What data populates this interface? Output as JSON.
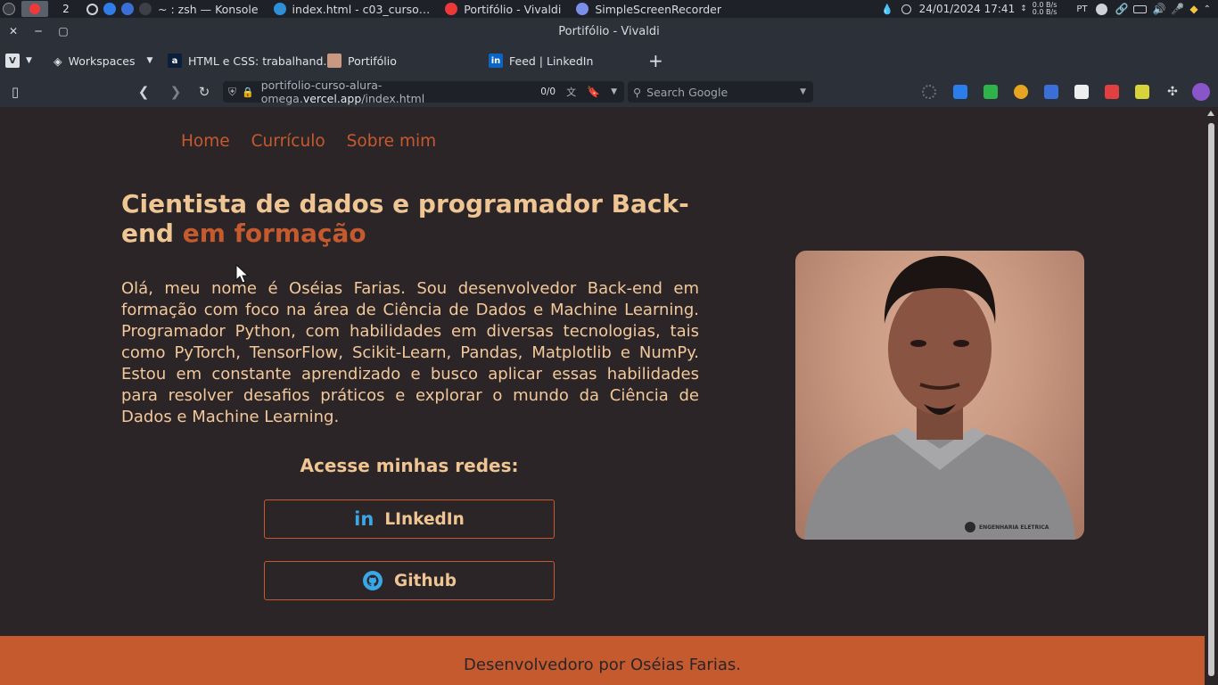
{
  "taskbar": {
    "desktop_number": "2",
    "tasks": [
      {
        "label": "~ : zsh — Konsole",
        "icon": "terminal-icon"
      },
      {
        "label": "index.html - c03_curso…",
        "icon": "vscode-icon"
      },
      {
        "label": "Portifólio - Vivaldi",
        "icon": "vivaldi-icon"
      },
      {
        "label": "SimpleScreenRecorder",
        "icon": "recorder-icon"
      }
    ],
    "datetime": "24/01/2024 17:41",
    "net_up": "0.0 B/s",
    "net_down": "0.0 B/s",
    "keyboard_layout": "PT"
  },
  "browser": {
    "window_title": "Portifólio - Vivaldi",
    "workspaces_label": "Workspaces",
    "tabs": [
      {
        "label": "HTML e CSS: trabalhand…",
        "icon": "alura-icon"
      },
      {
        "label": "Portifólio",
        "icon": "profile-photo-icon"
      },
      {
        "label": "Feed | LinkedIn",
        "icon": "linkedin-icon"
      }
    ],
    "url_prefix": "portifolio-curso-alura-omega.",
    "url_domain": "vercel.app",
    "url_path": "/index.html",
    "find_count": "0/0",
    "search_placeholder": "Search Google"
  },
  "site": {
    "nav": [
      "Home",
      "Currículo",
      "Sobre mim"
    ],
    "headline_part1": "Cientista de dados e programador Back-end",
    "headline_accent": "em formação",
    "bio": "Olá, meu nome é Oséias Farias. Sou desenvolvedor Back-end em formação com foco na área de Ciência de Dados e Machine Learning. Programador Python, com habilidades em diversas tecnologias, tais como PyTorch, TensorFlow, Scikit-Learn, Pandas, Matplotlib e NumPy. Estou em constante aprendizado e busco aplicar essas habilidades para resolver desafios práticos e explorar o mundo da Ciência de Dados e Machine Learning.",
    "social_title": "Acesse minhas redes:",
    "social": [
      {
        "label": "LInkedIn",
        "icon": "linkedin-icon"
      },
      {
        "label": "Github",
        "icon": "github-icon"
      }
    ],
    "shirt_logo_text": "ENGENHARIA ELETRICA",
    "footer": "Desenvolvedoro por Oséias Farias."
  },
  "colors": {
    "page_bg": "#2b2527",
    "accent": "#c65a2f",
    "text": "#f0c594",
    "chrome_bg": "#2c3038",
    "link_icon_blue": "#3aa7e8"
  }
}
